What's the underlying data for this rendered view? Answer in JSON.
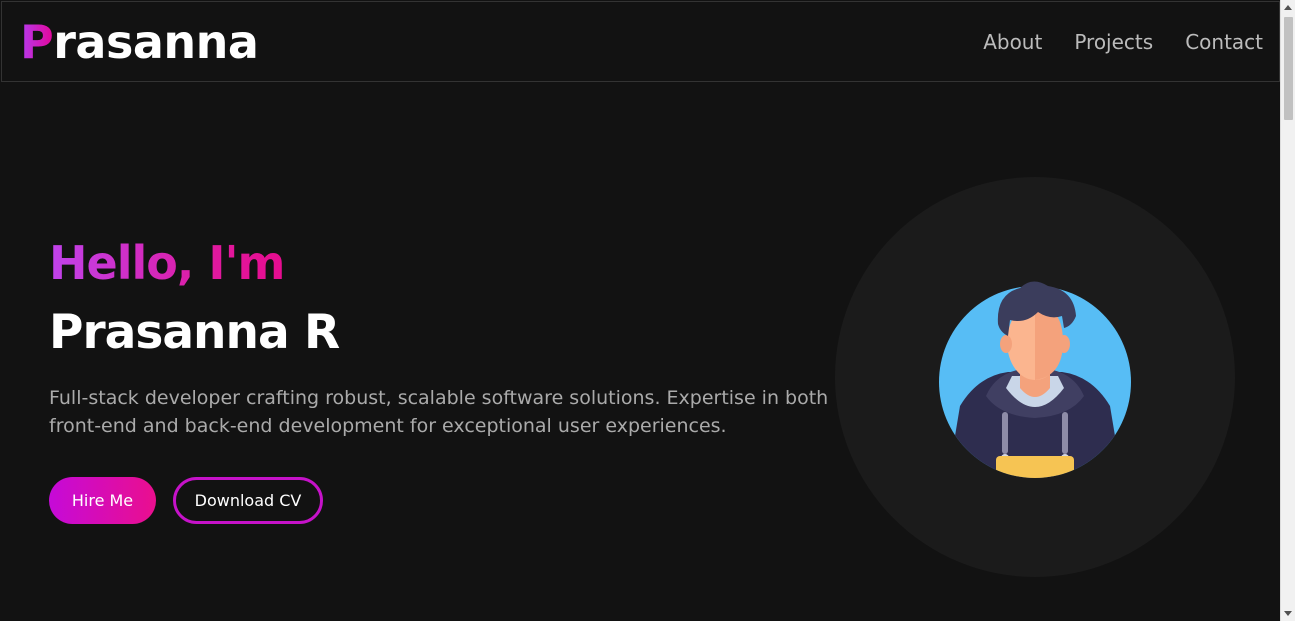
{
  "header": {
    "logo_first": "P",
    "logo_rest": "rasanna",
    "nav": [
      {
        "label": "About"
      },
      {
        "label": "Projects"
      },
      {
        "label": "Contact"
      }
    ]
  },
  "hero": {
    "greeting": "Hello, I'm",
    "name": "Prasanna R",
    "description_line1": "Full-stack developer crafting robust, scalable software solutions. Expertise in both",
    "description_line2": "front-end and back-end development for exceptional user experiences.",
    "primary_button": "Hire Me",
    "secondary_button": "Download CV"
  },
  "colors": {
    "background": "#121212",
    "accent_start": "#c043ec",
    "accent_end": "#e60c8f",
    "avatar_bg": "#57bdf5"
  },
  "icons": {
    "avatar": "developer-avatar-icon",
    "scroll_up": "chevron-up-icon",
    "scroll_down": "chevron-down-icon"
  }
}
